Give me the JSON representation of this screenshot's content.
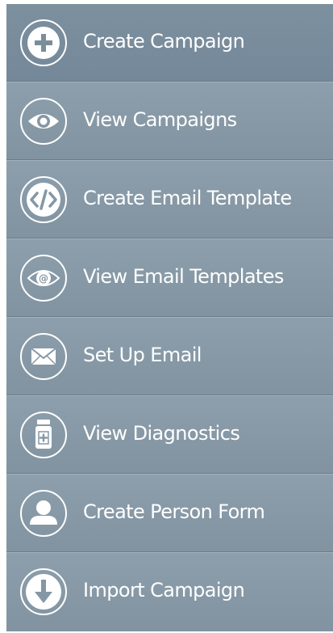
{
  "menu": {
    "items": [
      {
        "label": "Create Campaign",
        "icon": "plus-circle-icon",
        "active": true
      },
      {
        "label": "View Campaigns",
        "icon": "eye-icon",
        "active": false
      },
      {
        "label": "Create Email Template",
        "icon": "code-icon",
        "active": false
      },
      {
        "label": "View Email Templates",
        "icon": "eye-at-icon",
        "active": false
      },
      {
        "label": "Set Up Email",
        "icon": "envelope-icon",
        "active": false
      },
      {
        "label": "View Diagnostics",
        "icon": "medicine-bottle-icon",
        "active": false
      },
      {
        "label": "Create Person Form",
        "icon": "person-icon",
        "active": false
      },
      {
        "label": "Import Campaign",
        "icon": "download-arrow-icon",
        "active": false
      }
    ]
  },
  "colors": {
    "menu_background": "#8497a5",
    "active_background": "#7a8d9b",
    "text": "#ffffff",
    "divider": "#6b7d8a"
  }
}
